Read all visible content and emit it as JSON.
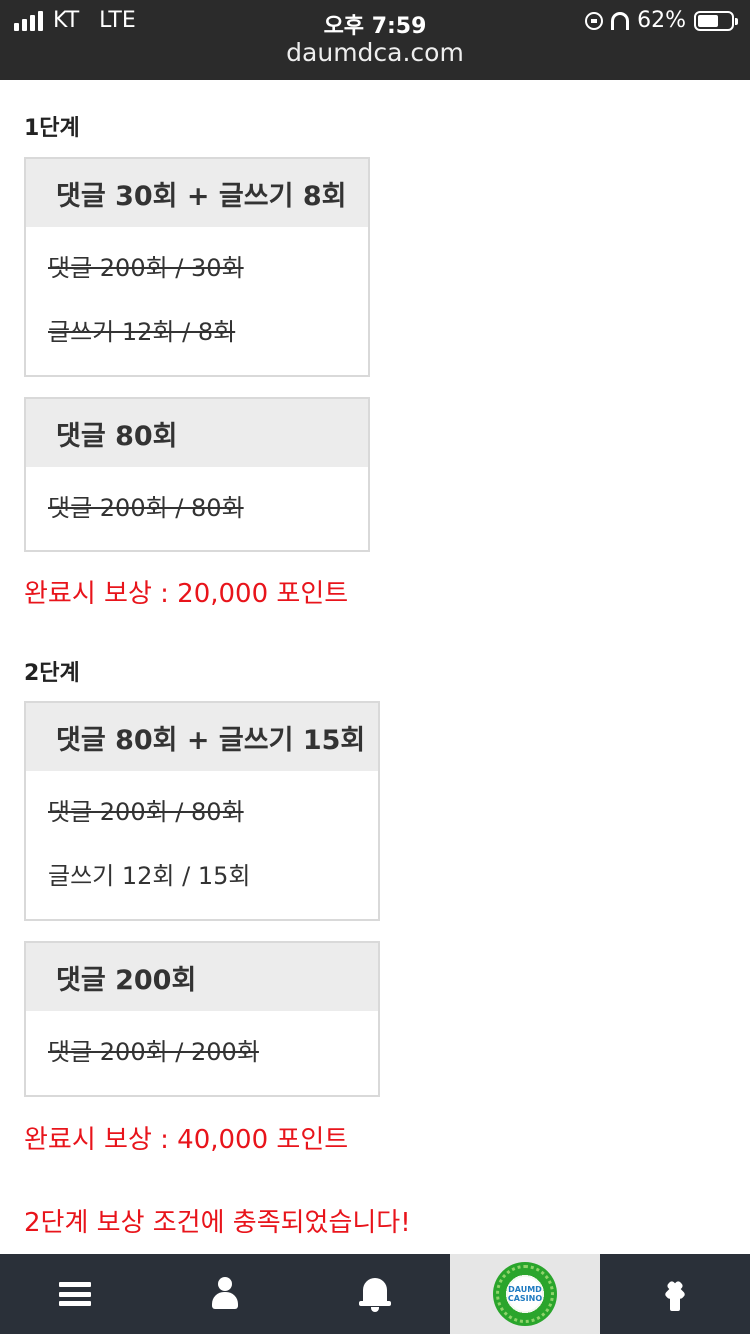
{
  "status_bar": {
    "carrier": "KT",
    "network": "LTE",
    "time": "오후 7:59",
    "battery_percent": "62%",
    "battery_level": 0.62,
    "url": "daumdca.com"
  },
  "steps": [
    {
      "title": "1단계",
      "boxes": [
        {
          "header": "댓글 30회 + 글쓰기 8회",
          "lines": [
            {
              "text": "댓글 200회 / 30회",
              "completed": true
            },
            {
              "text": "글쓰기 12회 / 8회",
              "completed": true
            }
          ]
        },
        {
          "header": "댓글 80회",
          "lines": [
            {
              "text": "댓글 200회 / 80회",
              "completed": true
            }
          ]
        }
      ],
      "reward": "완료시 보상 : 20,000 포인트"
    },
    {
      "title": "2단계",
      "boxes": [
        {
          "header": "댓글 80회 + 글쓰기 15회",
          "lines": [
            {
              "text": "댓글 200회 / 80회",
              "completed": true
            },
            {
              "text": "글쓰기 12회 / 15회",
              "completed": false
            }
          ]
        },
        {
          "header": "댓글 200회",
          "lines": [
            {
              "text": "댓글 200회 / 200회",
              "completed": true
            }
          ]
        }
      ],
      "reward": "완료시 보상 : 40,000 포인트"
    }
  ],
  "notice": "2단계 보상 조건에 충족되었습니다!",
  "colors": {
    "accent_red": "#e8141b",
    "nav_bg": "#2a3039",
    "status_bg": "#2b2b2b"
  },
  "bottom_nav": {
    "items": [
      {
        "icon": "menu-icon"
      },
      {
        "icon": "user-icon"
      },
      {
        "icon": "bell-icon"
      },
      {
        "icon": "daumd-casino-logo",
        "logo_text": "DAUMD CASINO",
        "active": true
      },
      {
        "icon": "arrow-up-icon"
      }
    ]
  }
}
